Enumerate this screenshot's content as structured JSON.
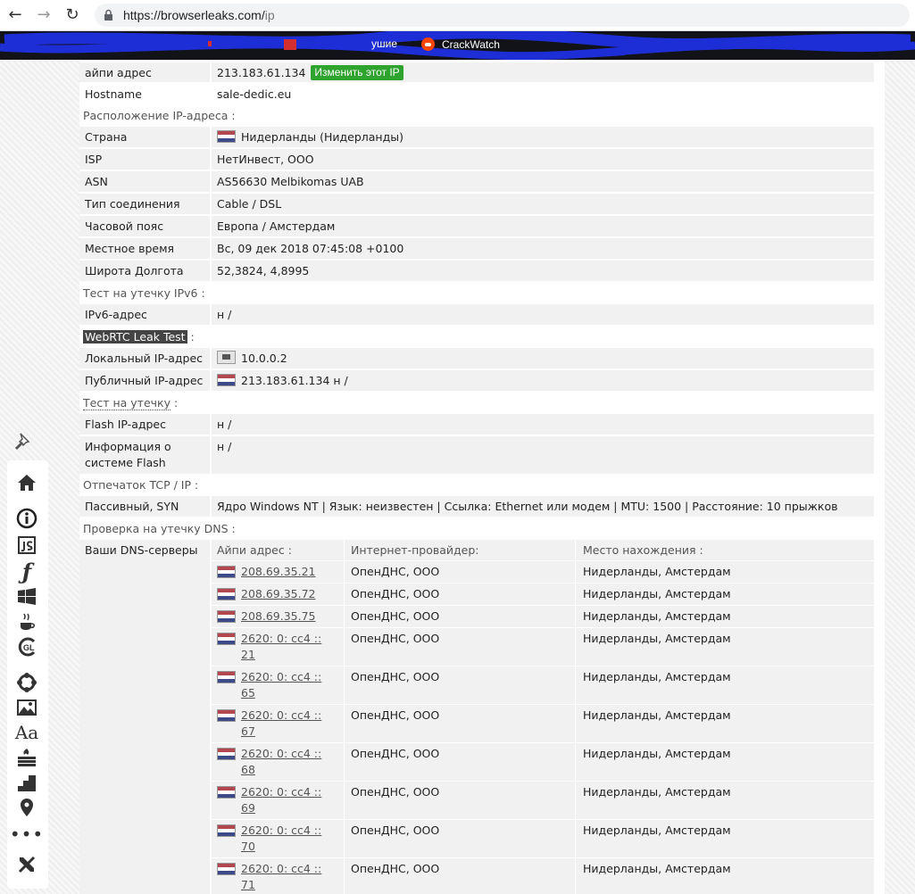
{
  "browser": {
    "url_host": "https://browserleaks.com/",
    "url_path": "ip",
    "bookmark_visible": "CrackWatch",
    "bookmark_partial": "ушие"
  },
  "ip_info": {
    "rows": [
      {
        "label": "айпи адрес",
        "value": "213.183.61.134",
        "button": "Изменить этот IP"
      },
      {
        "label": "Hostname",
        "value": "sale-dedic.eu"
      }
    ]
  },
  "location": {
    "heading": "Расположение IP-адреса :",
    "rows": [
      {
        "label": "Страна",
        "value": "Нидерланды (Нидерланды)"
      },
      {
        "label": "ISP",
        "value": "НетИнвест, ООО"
      },
      {
        "label": "ASN",
        "value": "AS56630 Melbikomas UAB"
      },
      {
        "label": "Тип соединения",
        "value": "Cable / DSL"
      },
      {
        "label": "Часовой пояс",
        "value": "Европа / Амстердам"
      },
      {
        "label": "Местное время",
        "value": "Вс, 09 дек 2018 07:45:08 +0100"
      },
      {
        "label": "Широта Долгота",
        "value": "52,3824, 4,8995"
      }
    ]
  },
  "ipv6": {
    "heading": "Тест на утечку IPv6 :",
    "rows": [
      {
        "label": "IPv6-адрес",
        "value": "н /"
      }
    ]
  },
  "webrtc": {
    "heading_highlight": "WebRTC Leak Test",
    "heading_suffix": " :",
    "rows": [
      {
        "label": "Локальный IP-адрес",
        "value": "10.0.0.2"
      },
      {
        "label": "Публичный IP-адрес",
        "value": "213.183.61.134 н /"
      }
    ]
  },
  "flash": {
    "heading": "Тест на утечку",
    "heading_suffix": " :",
    "rows": [
      {
        "label": "Flash IP-адрес",
        "value": "н /"
      },
      {
        "label": "Информация о системе Flash",
        "value": "н /"
      }
    ]
  },
  "tcp": {
    "heading": "Отпечаток TCP / IP :",
    "rows": [
      {
        "label": "Пассивный, SYN",
        "value": "Ядро Windows NT | Язык: неизвестен | Ссылка: Ethernet или модем | MTU: 1500 | Расстояние: 10 прыжков"
      }
    ]
  },
  "dns": {
    "heading": "Проверка на утечку DNS :",
    "label": "Ваши DNS-серверы",
    "columns": {
      "ip": "Айпи адрес :",
      "isp": "Интернет-провайдер:",
      "location": "Место нахождения :"
    },
    "servers": [
      {
        "ip": "208.69.35.21",
        "isp": "ОпенДНС, ООО",
        "location": "Нидерланды, Амстердам"
      },
      {
        "ip": "208.69.35.72",
        "isp": "ОпенДНС, ООО",
        "location": "Нидерланды, Амстердам"
      },
      {
        "ip": "208.69.35.75",
        "isp": "ОпенДНС, ООО",
        "location": "Нидерланды, Амстердам"
      },
      {
        "ip": "2620: 0: cc4 :: 21",
        "isp": "ОпенДНС, ООО",
        "location": "Нидерланды, Амстердам"
      },
      {
        "ip": "2620: 0: cc4 :: 65",
        "isp": "ОпенДНС, ООО",
        "location": "Нидерланды, Амстердам"
      },
      {
        "ip": "2620: 0: cc4 :: 67",
        "isp": "ОпенДНС, ООО",
        "location": "Нидерланды, Амстердам"
      },
      {
        "ip": "2620: 0: cc4 :: 68",
        "isp": "ОпенДНС, ООО",
        "location": "Нидерланды, Амстердам"
      },
      {
        "ip": "2620: 0: cc4 :: 69",
        "isp": "ОпенДНС, ООО",
        "location": "Нидерланды, Амстердам"
      },
      {
        "ip": "2620: 0: cc4 :: 70",
        "isp": "ОпенДНС, ООО",
        "location": "Нидерланды, Амстердам"
      },
      {
        "ip": "2620: 0: cc4 :: 71",
        "isp": "ОпенДНС, ООО",
        "location": "Нидерланды, Амстердам"
      }
    ]
  },
  "sidebar_icons": [
    "pin-icon",
    "home-icon",
    "info-icon",
    "javascript-icon",
    "flash-icon",
    "windows-icon",
    "java-icon",
    "webgl-icon",
    "fonts-icon",
    "image-icon",
    "font-icon",
    "firewall-icon",
    "steps-icon",
    "location-icon",
    "more-icon",
    "tools-icon"
  ],
  "colors": {
    "change_button": "#2ea32e",
    "flag_red": "#b3474f",
    "flag_blue": "#3c4a88",
    "bookmarks_bg": "#121318"
  }
}
